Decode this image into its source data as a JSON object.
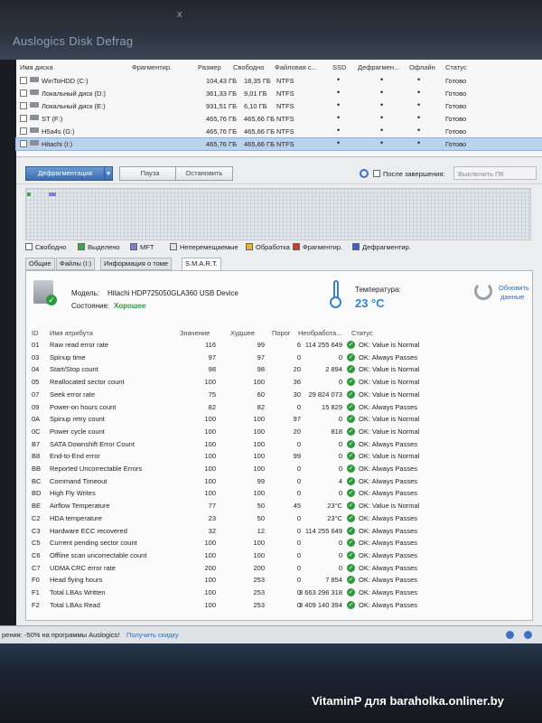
{
  "window": {
    "title": "Auslogics Disk Defrag",
    "title_close": "x"
  },
  "disks": {
    "headers": [
      "Имя диска",
      "Фрагментир.",
      "Размер",
      "Свободно",
      "Файловая с...",
      "SSD",
      "Дефрагмен...",
      "Офлайн",
      "Статус"
    ],
    "rows": [
      {
        "name": "WinToHDD (C:)",
        "size": "104,43 ГБ",
        "free": "18,35 ГБ",
        "fs": "NTFS",
        "ssd": "•",
        "defrag": "•",
        "offline": "•",
        "status": "Готово",
        "selected": false
      },
      {
        "name": "Локальный диск (D:)",
        "size": "361,33 ГБ",
        "free": "9,01 ГБ",
        "fs": "NTFS",
        "ssd": "•",
        "defrag": "•",
        "offline": "•",
        "status": "Готово",
        "selected": false
      },
      {
        "name": "Локальный диск (E:)",
        "size": "931,51 ГБ",
        "free": "6,10 ГБ",
        "fs": "NTFS",
        "ssd": "•",
        "defrag": "•",
        "offline": "•",
        "status": "Готово",
        "selected": false
      },
      {
        "name": "ST (F:)",
        "size": "465,76 ГБ",
        "free": "465,66 ГБ",
        "fs": "NTFS",
        "ssd": "•",
        "defrag": "•",
        "offline": "•",
        "status": "Готово",
        "selected": false
      },
      {
        "name": "Н5a4s (G:)",
        "size": "465,76 ГБ",
        "free": "465,66 ГБ",
        "fs": "NTFS",
        "ssd": "•",
        "defrag": "•",
        "offline": "•",
        "status": "Готово",
        "selected": false
      },
      {
        "name": "Hitachi (I:)",
        "size": "465,76 ГБ",
        "free": "465,66 ГБ",
        "fs": "NTFS",
        "ssd": "•",
        "defrag": "•",
        "offline": "•",
        "status": "Готово",
        "selected": true
      }
    ]
  },
  "toolbar": {
    "defrag": "Дефрагментация",
    "dropdown": "▾",
    "pause": "Пауза",
    "stop": "Остановить",
    "after_label": "После завершения:",
    "after_value": "Выключить ПК"
  },
  "legend": [
    "Свободно",
    "Выделено",
    "MFT",
    "Неперемещаемые",
    "Обработка",
    "Фрагментир.",
    "Дефрагментир."
  ],
  "legend_colors": [
    "#ffffff",
    "#3aa64a",
    "#7d7fd8",
    "#e0e0e0",
    "#e8b22c",
    "#d43a2a",
    "#3a63c8"
  ],
  "tabs": [
    "Общие",
    "Файлы (I:)",
    "Информация о томе",
    "S.M.A.R.T."
  ],
  "drive": {
    "model_label": "Модель:",
    "model": "Hitachi HDP725050GLA360 USB Device",
    "state_label": "Состояние:",
    "state": "Хорошее",
    "temp_label": "Температура:",
    "temp": "23 °C",
    "refresh_line1": "Обновить",
    "refresh_line2": "данные"
  },
  "smart": {
    "headers": [
      "ID",
      "Имя атрибута",
      "Значение",
      "Худшее",
      "Порог",
      "Необработа...",
      "Статус"
    ],
    "rows": [
      [
        "01",
        "Raw read error rate",
        "116",
        "99",
        "6",
        "114 255 649",
        "OK: Value is Normal"
      ],
      [
        "03",
        "Spinup time",
        "97",
        "97",
        "0",
        "0",
        "OK: Always Passes"
      ],
      [
        "04",
        "Start/Stop count",
        "98",
        "98",
        "20",
        "2 894",
        "OK: Value is Normal"
      ],
      [
        "05",
        "Reallocated sector count",
        "100",
        "100",
        "36",
        "0",
        "OK: Value is Normal"
      ],
      [
        "07",
        "Seek error rate",
        "75",
        "60",
        "30",
        "29 824 073",
        "OK: Value is Normal"
      ],
      [
        "09",
        "Power-on hours count",
        "82",
        "82",
        "0",
        "15 829",
        "OK: Always Passes"
      ],
      [
        "0A",
        "Spinup retry count",
        "100",
        "100",
        "97",
        "0",
        "OK: Value is Normal"
      ],
      [
        "0C",
        "Power cycle count",
        "100",
        "100",
        "20",
        "818",
        "OK: Value is Normal"
      ],
      [
        "B7",
        "SATA Downshift Error Count",
        "100",
        "100",
        "0",
        "0",
        "OK: Always Passes"
      ],
      [
        "B8",
        "End-to-End error",
        "100",
        "100",
        "99",
        "0",
        "OK: Value is Normal"
      ],
      [
        "BB",
        "Reported Uncorrectable Errors",
        "100",
        "100",
        "0",
        "0",
        "OK: Always Passes"
      ],
      [
        "BC",
        "Command Timeout",
        "100",
        "99",
        "0",
        "4",
        "OK: Always Passes"
      ],
      [
        "BD",
        "High Fly Writes",
        "100",
        "100",
        "0",
        "0",
        "OK: Always Passes"
      ],
      [
        "BE",
        "Airflow Temperature",
        "77",
        "50",
        "45",
        "23°C",
        "OK: Value is Normal"
      ],
      [
        "C2",
        "HDA temperature",
        "23",
        "50",
        "0",
        "23°C",
        "OK: Always Passes"
      ],
      [
        "C3",
        "Hardware ECC recovered",
        "32",
        "12",
        "0",
        "114 255 649",
        "OK: Always Passes"
      ],
      [
        "C5",
        "Current pending sector count",
        "100",
        "100",
        "0",
        "0",
        "OK: Always Passes"
      ],
      [
        "C6",
        "Offline scan uncorrectable count",
        "100",
        "100",
        "0",
        "0",
        "OK: Always Passes"
      ],
      [
        "C7",
        "UDMA CRC error rate",
        "200",
        "200",
        "0",
        "0",
        "OK: Always Passes"
      ],
      [
        "F0",
        "Head flying hours",
        "100",
        "253",
        "0",
        "7 854",
        "OK: Always Passes"
      ],
      [
        "F1",
        "Total LBAs Written",
        "100",
        "253",
        "0",
        "3 663 296 318",
        "OK: Always Passes"
      ],
      [
        "F2",
        "Total LBAs Read",
        "100",
        "253",
        "0",
        "3 409 140 394",
        "OK: Always Passes"
      ]
    ]
  },
  "statusbar": {
    "promo": "рения: -50% на программы Auslogics!",
    "link": "Получить скидку"
  },
  "watermark": "VitaminP для baraholka.onliner.by"
}
